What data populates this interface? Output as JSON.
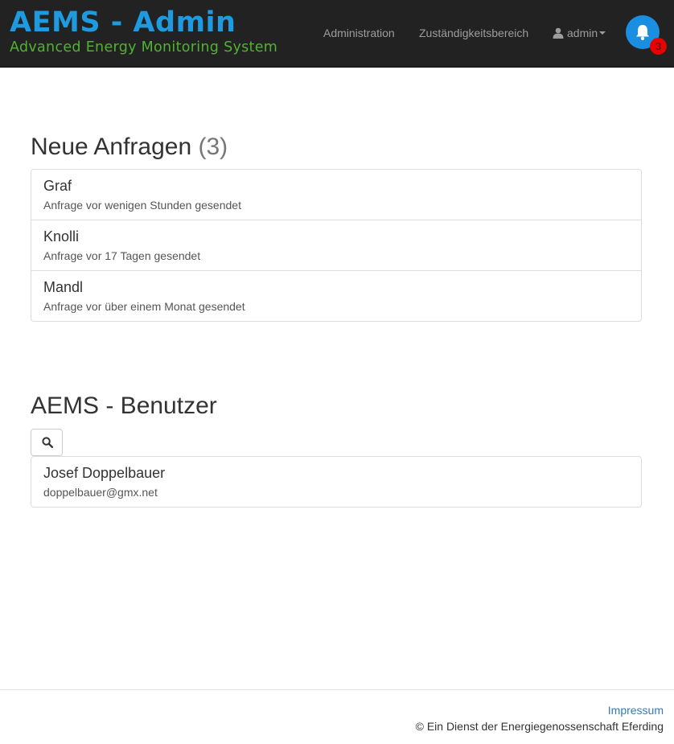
{
  "brand": {
    "title": "AEMS - Admin",
    "subtitle": "Advanced Energy Monitoring System"
  },
  "nav": {
    "administration": "Administration",
    "responsibility": "Zuständigkeitsbereich",
    "user": "admin",
    "notification_count": "3"
  },
  "requests": {
    "title": "Neue Anfragen",
    "count": "(3)",
    "items": [
      {
        "name": "Graf",
        "info": "Anfrage vor wenigen Stunden gesendet"
      },
      {
        "name": "Knolli",
        "info": "Anfrage vor 17 Tagen gesendet"
      },
      {
        "name": "Mandl",
        "info": "Anfrage vor über einem Monat gesendet"
      }
    ]
  },
  "users": {
    "title": "AEMS - Benutzer",
    "items": [
      {
        "name": "Josef Doppelbauer",
        "email": "doppelbauer@gmx.net"
      }
    ]
  },
  "footer": {
    "impressum": "Impressum",
    "copyright": "© Ein Dienst der Energiegenossenschaft Eferding"
  },
  "colors": {
    "navbar": "#222222",
    "brand_title": "#1e9be0",
    "brand_subtitle": "#4fb331",
    "bell": "#1a8ee0",
    "badge": "#e90000",
    "link": "#337ab7"
  },
  "icons": [
    "user-icon",
    "caret-down-icon",
    "bell-icon",
    "search-icon"
  ]
}
